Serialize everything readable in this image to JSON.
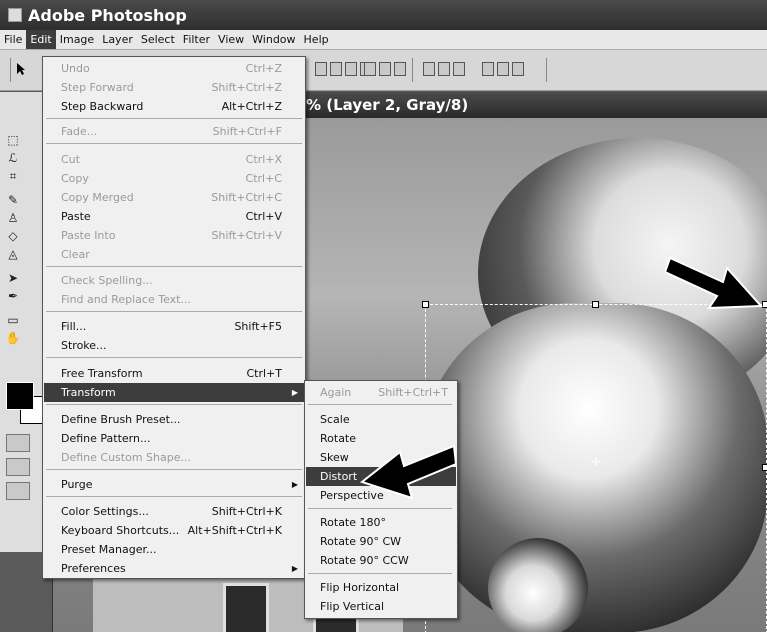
{
  "window": {
    "title": "Adobe Photoshop"
  },
  "menubar": {
    "items": [
      "File",
      "Edit",
      "Image",
      "Layer",
      "Select",
      "Filter",
      "View",
      "Window",
      "Help"
    ],
    "active": "Edit"
  },
  "document": {
    "title_fragment": "% (Layer 2, Gray/8)"
  },
  "edit_menu": {
    "items": [
      {
        "label": "Undo",
        "shortcut": "Ctrl+Z",
        "enabled": false
      },
      {
        "label": "Step Forward",
        "shortcut": "Shift+Ctrl+Z",
        "enabled": false
      },
      {
        "label": "Step Backward",
        "shortcut": "Alt+Ctrl+Z",
        "enabled": true
      },
      {
        "label": "Fade...",
        "shortcut": "Shift+Ctrl+F",
        "enabled": false
      },
      {
        "label": "Cut",
        "shortcut": "Ctrl+X",
        "enabled": false
      },
      {
        "label": "Copy",
        "shortcut": "Ctrl+C",
        "enabled": false
      },
      {
        "label": "Copy Merged",
        "shortcut": "Shift+Ctrl+C",
        "enabled": false
      },
      {
        "label": "Paste",
        "shortcut": "Ctrl+V",
        "enabled": true
      },
      {
        "label": "Paste Into",
        "shortcut": "Shift+Ctrl+V",
        "enabled": false
      },
      {
        "label": "Clear",
        "shortcut": "",
        "enabled": false
      },
      {
        "label": "Check Spelling...",
        "shortcut": "",
        "enabled": false
      },
      {
        "label": "Find and Replace Text...",
        "shortcut": "",
        "enabled": false
      },
      {
        "label": "Fill...",
        "shortcut": "Shift+F5",
        "enabled": true
      },
      {
        "label": "Stroke...",
        "shortcut": "",
        "enabled": true
      },
      {
        "label": "Free Transform",
        "shortcut": "Ctrl+T",
        "enabled": true
      },
      {
        "label": "Transform",
        "shortcut": "",
        "enabled": true,
        "highlighted": true,
        "submenu": true
      },
      {
        "label": "Define Brush Preset...",
        "shortcut": "",
        "enabled": true
      },
      {
        "label": "Define Pattern...",
        "shortcut": "",
        "enabled": true
      },
      {
        "label": "Define Custom Shape...",
        "shortcut": "",
        "enabled": false
      },
      {
        "label": "Purge",
        "shortcut": "",
        "enabled": true,
        "submenu": true
      },
      {
        "label": "Color Settings...",
        "shortcut": "Shift+Ctrl+K",
        "enabled": true
      },
      {
        "label": "Keyboard Shortcuts...",
        "shortcut": "Alt+Shift+Ctrl+K",
        "enabled": true
      },
      {
        "label": "Preset Manager...",
        "shortcut": "",
        "enabled": true
      },
      {
        "label": "Preferences",
        "shortcut": "",
        "enabled": true,
        "submenu": true
      }
    ]
  },
  "transform_menu": {
    "items": [
      {
        "label": "Again",
        "shortcut": "Shift+Ctrl+T",
        "enabled": false
      },
      {
        "label": "Scale",
        "shortcut": "",
        "enabled": true
      },
      {
        "label": "Rotate",
        "shortcut": "",
        "enabled": true
      },
      {
        "label": "Skew",
        "shortcut": "",
        "enabled": true
      },
      {
        "label": "Distort",
        "shortcut": "",
        "enabled": true,
        "highlighted": true
      },
      {
        "label": "Perspective",
        "shortcut": "",
        "enabled": true
      },
      {
        "label": "Rotate 180°",
        "shortcut": "",
        "enabled": true
      },
      {
        "label": "Rotate 90° CW",
        "shortcut": "",
        "enabled": true
      },
      {
        "label": "Rotate 90° CCW",
        "shortcut": "",
        "enabled": true
      },
      {
        "label": "Flip Horizontal",
        "shortcut": "",
        "enabled": true
      },
      {
        "label": "Flip Vertical",
        "shortcut": "",
        "enabled": true
      }
    ]
  },
  "colors": {
    "highlight": "#3d3d3d",
    "menu_bg": "#f0f0f0",
    "disabled": "#9a9a9a"
  }
}
